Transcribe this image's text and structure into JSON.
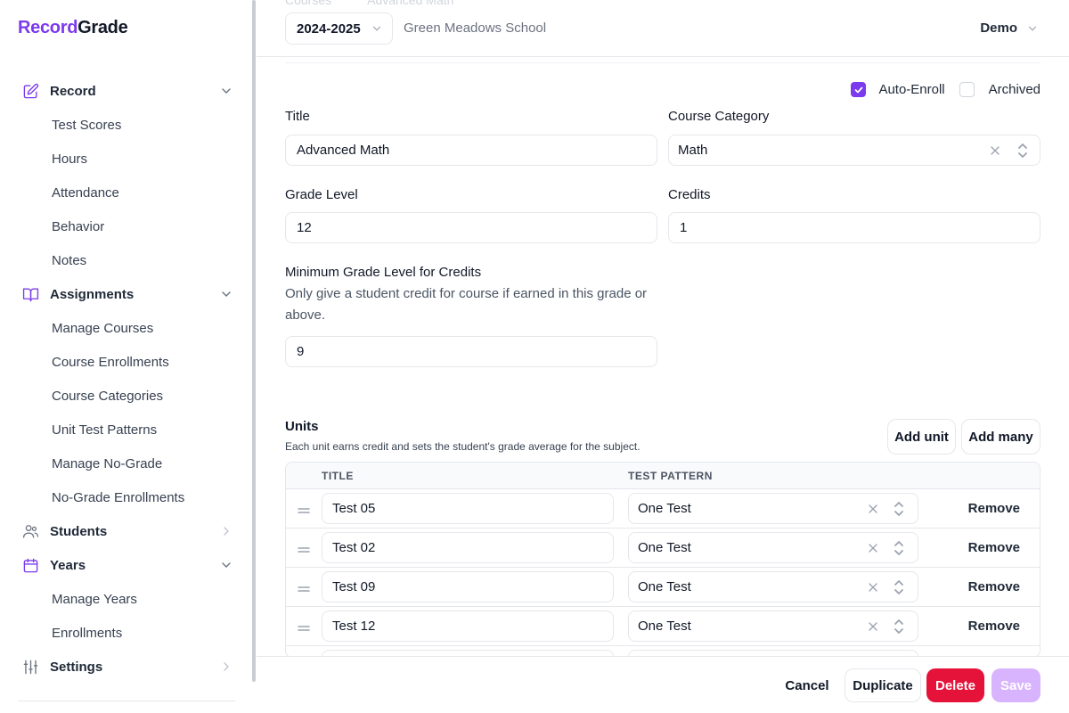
{
  "brand": {
    "part1": "Record",
    "part2": "Grade"
  },
  "sidebar": {
    "groups": [
      {
        "label": "Record",
        "icon": "pencil-square-icon",
        "items": [
          "Test Scores",
          "Hours",
          "Attendance",
          "Behavior",
          "Notes"
        ]
      },
      {
        "label": "Assignments",
        "icon": "book-open-icon",
        "items": [
          "Manage Courses",
          "Course Enrollments",
          "Course Categories",
          "Unit Test Patterns",
          "Manage No-Grade",
          "No-Grade Enrollments"
        ]
      },
      {
        "label": "Students",
        "icon": "users-icon",
        "items": []
      },
      {
        "label": "Years",
        "icon": "calendar-icon",
        "items": [
          "Manage Years",
          "Enrollments"
        ]
      },
      {
        "label": "Settings",
        "icon": "sliders-icon",
        "items": []
      }
    ]
  },
  "header": {
    "breadcrumb": [
      "Courses",
      "Advanced Math"
    ],
    "year": "2024-2025",
    "school": "Green Meadows School",
    "user": "Demo"
  },
  "form": {
    "auto_enroll": {
      "label": "Auto-Enroll",
      "checked": true
    },
    "archived": {
      "label": "Archived",
      "checked": false
    },
    "title": {
      "label": "Title",
      "value": "Advanced Math"
    },
    "category": {
      "label": "Course Category",
      "value": "Math"
    },
    "grade_level": {
      "label": "Grade Level",
      "value": "12"
    },
    "credits": {
      "label": "Credits",
      "value": "1"
    },
    "min_grade": {
      "label": "Minimum Grade Level for Credits",
      "help": "Only give a student credit for course if earned in this grade or above.",
      "value": "9"
    }
  },
  "units": {
    "title": "Units",
    "description": "Each unit earns credit and sets the student's grade average for the subject.",
    "add_unit": "Add unit",
    "add_many": "Add many",
    "columns": [
      "TITLE",
      "TEST PATTERN"
    ],
    "rows": [
      {
        "title": "Test 05",
        "pattern": "One Test",
        "action": "Remove"
      },
      {
        "title": "Test 02",
        "pattern": "One Test",
        "action": "Remove"
      },
      {
        "title": "Test 09",
        "pattern": "One Test",
        "action": "Remove"
      },
      {
        "title": "Test 12",
        "pattern": "One Test",
        "action": "Remove"
      }
    ]
  },
  "footer": {
    "cancel": "Cancel",
    "duplicate": "Duplicate",
    "delete": "Delete",
    "save": "Save"
  },
  "colors": {
    "accent": "#7c3aed",
    "danger": "#e5133a",
    "save_disabled": "#d8b4fe"
  }
}
